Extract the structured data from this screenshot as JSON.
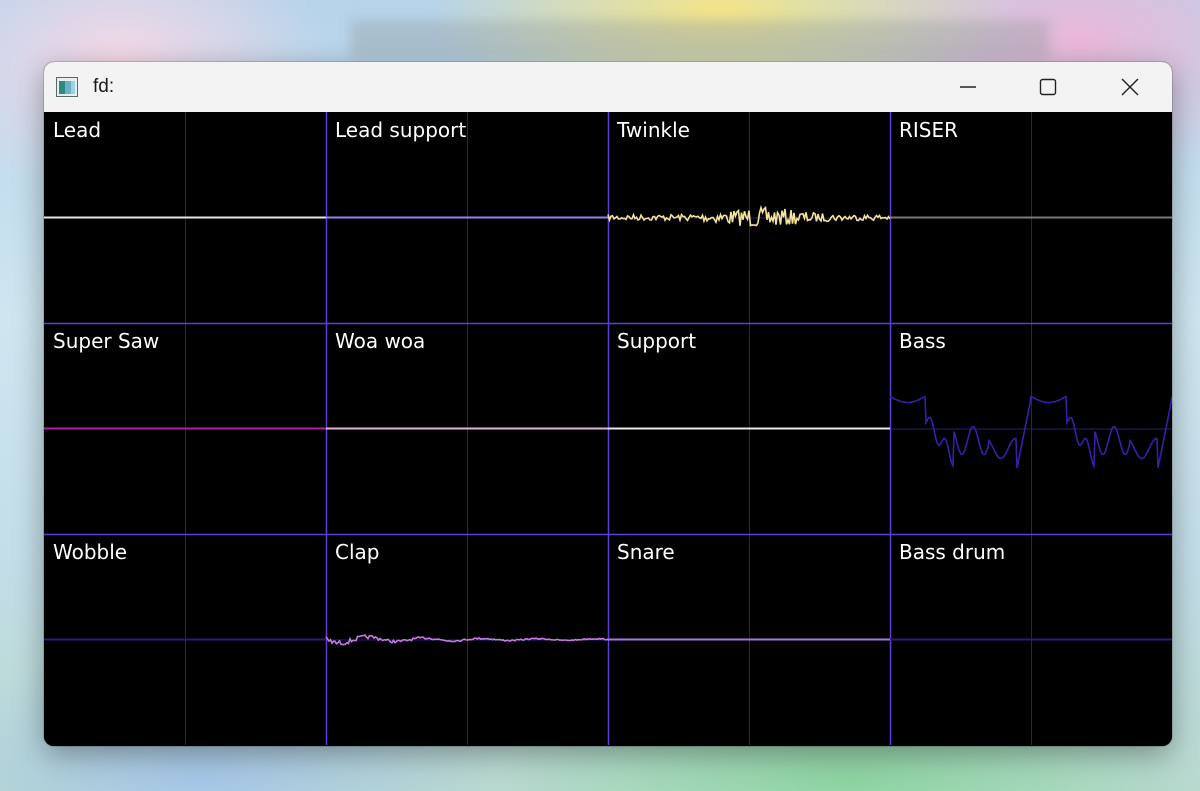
{
  "window": {
    "title": "fd:",
    "controls": {
      "minimize_icon": "minimize-icon",
      "maximize_icon": "maximize-icon",
      "close_icon": "close-icon"
    }
  },
  "colors": {
    "grid_major": "#5b3fd6",
    "grid_minor": "#2a1f6e",
    "label": "#ffffff",
    "background": "#000000"
  },
  "oscilloscopes": [
    {
      "label": "Lead",
      "color": "#e6e6e6",
      "waveform": "flat"
    },
    {
      "label": "Lead support",
      "color": "#8f86f0",
      "waveform": "flat"
    },
    {
      "label": "Twinkle",
      "color": "#f4e49a",
      "waveform": "noise"
    },
    {
      "label": "RISER",
      "color": "#7a7a7a",
      "waveform": "flat"
    },
    {
      "label": "Super Saw",
      "color": "#b01fa8",
      "waveform": "flat"
    },
    {
      "label": "Woa woa",
      "color": "#d8b6d0",
      "waveform": "flat"
    },
    {
      "label": "Support",
      "color": "#e8e8e8",
      "waveform": "flat"
    },
    {
      "label": "Bass",
      "color": "#3a1ea8",
      "waveform": "bass"
    },
    {
      "label": "Wobble",
      "color": "#2a1f6e",
      "waveform": "flat"
    },
    {
      "label": "Clap",
      "color": "#c77ae6",
      "waveform": "decay"
    },
    {
      "label": "Snare",
      "color": "#a876e6",
      "waveform": "flat"
    },
    {
      "label": "Bass drum",
      "color": "#2a1f6e",
      "waveform": "flat"
    }
  ]
}
